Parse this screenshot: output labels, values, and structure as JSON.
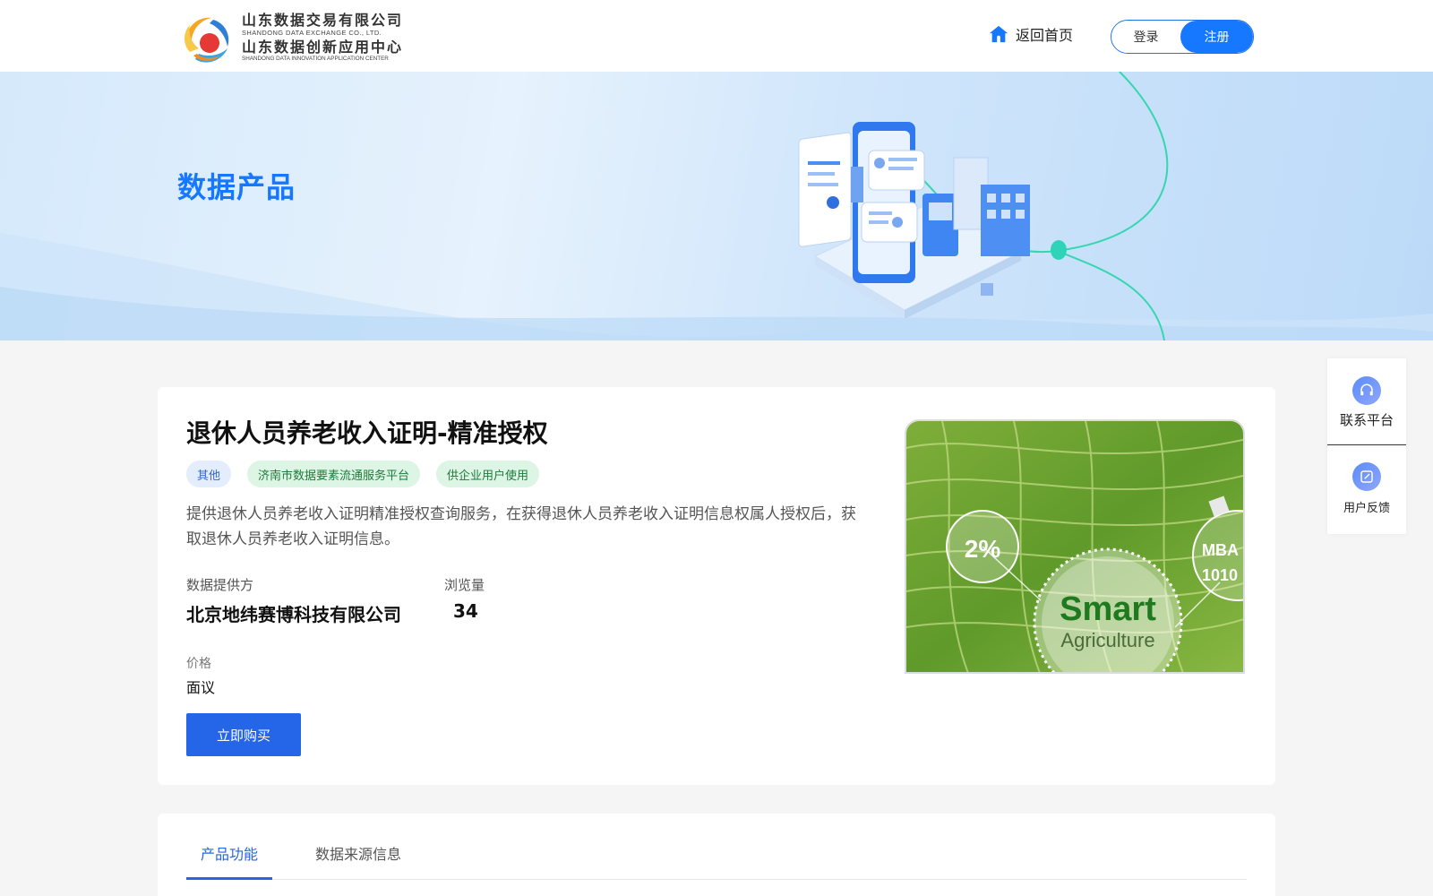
{
  "header": {
    "logo": {
      "name_cn_1": "山东数据交易有限公司",
      "name_en_1": "SHANDONG DATA EXCHANGE CO., LTD.",
      "name_cn_2": "山东数据创新应用中心",
      "name_en_2": "SHANDONG DATA INNOVATION APPLICATION CENTER"
    },
    "home_label": "返回首页",
    "login_label": "登录",
    "register_label": "注册"
  },
  "banner": {
    "title": "数据产品"
  },
  "product": {
    "title": "退休人员养老收入证明-精准授权",
    "tags": [
      "其他",
      "济南市数据要素流通服务平台",
      "供企业用户使用"
    ],
    "description": "提供退休人员养老收入证明精准授权查询服务，在获得退休人员养老收入证明信息权属人授权后，获取退休人员养老收入证明信息。",
    "provider_label": "数据提供方",
    "provider_value": "北京地纬赛博科技有限公司",
    "views_label": "浏览量",
    "views_value": "34",
    "price_label": "价格",
    "price_value": "面议",
    "buy_label": "立即购买",
    "image": {
      "badge_text": "2%",
      "main_text_1": "Smart",
      "main_text_2": "Agriculture",
      "side_text_1": "MBA",
      "side_text_2": "1010"
    }
  },
  "side_float": {
    "contact_label": "联系平台",
    "feedback_label": "用户反馈"
  },
  "tabs": [
    {
      "label": "产品功能",
      "active": true
    },
    {
      "label": "数据来源信息",
      "active": false
    }
  ],
  "colors": {
    "primary": "#1677ff",
    "button": "#2565e8",
    "tag_blue_bg": "#e3edfc",
    "tag_green_bg": "#dcf5e4"
  }
}
